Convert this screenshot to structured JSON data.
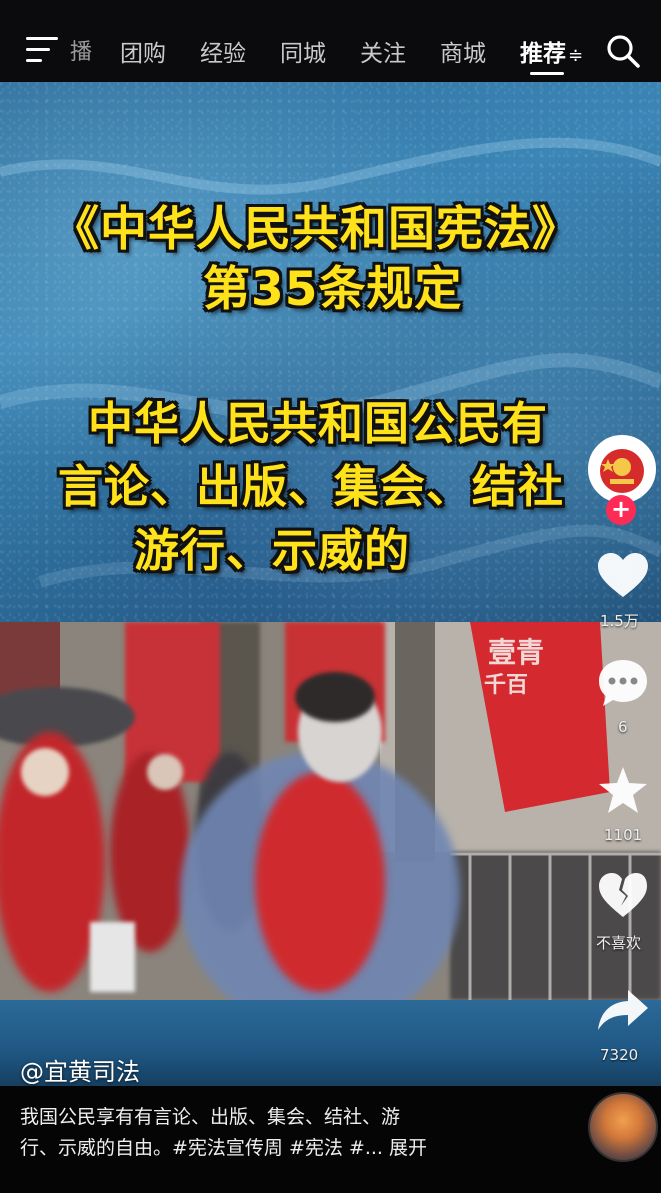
{
  "nav": {
    "cut_tab": "播",
    "tabs": [
      "团购",
      "经验",
      "同城",
      "关注",
      "商城"
    ],
    "active_tab": "推荐",
    "active_suffix": "≑"
  },
  "video": {
    "title_line1": "《中华人民共和国宪法》",
    "title_line2": "第35条规定",
    "body_line1": "中华人民共和国公民有",
    "body_line2": "言论、出版、集会、结社",
    "body_line3": "游行、示威的",
    "author": "@宜黄司法",
    "scene_banner_1": "壹青",
    "scene_banner_2": "千百"
  },
  "actions": {
    "like_count": "1.5万",
    "comment_count": "6",
    "favorite_count": "1101",
    "dislike_label": "不喜欢",
    "share_count": "7320"
  },
  "description": {
    "line1": "我国公民享有有言论、出版、集会、结社、游",
    "line2": "行、示威的自由。#宪法宣传周 #宪法 #...  展开"
  },
  "colors": {
    "caption_yellow": "#ffe21a",
    "follow_red": "#fe2c55",
    "banner_red": "#d42a2f"
  }
}
